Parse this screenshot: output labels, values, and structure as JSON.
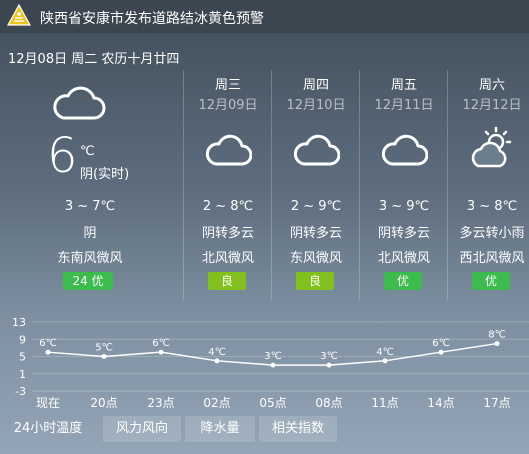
{
  "alert": {
    "icon": "ice-warning-icon",
    "color": "#f0c419",
    "text": "陕西省安康市发布道路结冰黄色预警"
  },
  "date_line": "12月08日 周二 农历十月廿四",
  "today": {
    "icon": "cloudy-icon",
    "temp": "6",
    "unit": "℃",
    "condition_now": "阴(实时)",
    "range": "3 ~ 7℃",
    "weather": "阴",
    "wind": "东南风微风",
    "aqi": "24  优",
    "aqi_color": "#3cbc4d"
  },
  "forecast": [
    {
      "day": "周三",
      "date": "12月09日",
      "icon": "cloudy-icon",
      "range": "2 ~ 8℃",
      "weather": "阴转多云",
      "wind": "北风微风",
      "aqi": "良",
      "aqi_color": "#82c11d"
    },
    {
      "day": "周四",
      "date": "12月10日",
      "icon": "cloudy-icon",
      "range": "2 ~ 9℃",
      "weather": "阴转多云",
      "wind": "东风微风",
      "aqi": "良",
      "aqi_color": "#82c11d"
    },
    {
      "day": "周五",
      "date": "12月11日",
      "icon": "cloudy-icon",
      "range": "3 ~ 9℃",
      "weather": "阴转多云",
      "wind": "北风微风",
      "aqi": "优",
      "aqi_color": "#3cbc4d"
    },
    {
      "day": "周六",
      "date": "12月12日",
      "icon": "partly-cloudy-icon",
      "range": "3 ~ 8℃",
      "weather": "多云转小雨",
      "wind": "西北风微风",
      "aqi": "优",
      "aqi_color": "#3cbc4d"
    }
  ],
  "chart_data": {
    "type": "line",
    "categories": [
      "现在",
      "20点",
      "23点",
      "02点",
      "05点",
      "08点",
      "11点",
      "14点",
      "17点"
    ],
    "values": [
      6,
      5,
      6,
      4,
      3,
      3,
      4,
      6,
      8
    ],
    "point_labels": [
      "6℃",
      "5℃",
      "6℃",
      "4℃",
      "3℃",
      "3℃",
      "4℃",
      "6℃",
      "8℃"
    ],
    "yticks": [
      "13",
      "9",
      "5",
      "1",
      "-3"
    ],
    "ylim": [
      -3,
      13
    ],
    "grid": true
  },
  "tabs": [
    "24小时温度",
    "风力风向",
    "降水量",
    "相关指数"
  ]
}
